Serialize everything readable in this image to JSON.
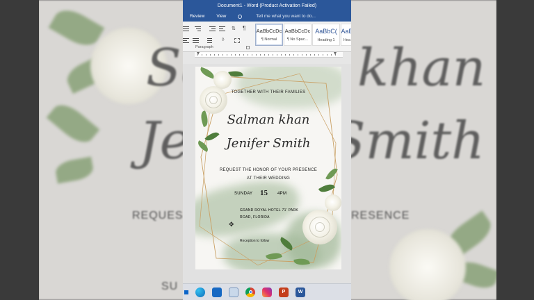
{
  "window": {
    "title": "Document1 - Word (Product Activation Failed)"
  },
  "menu": {
    "tabs": [
      "Review",
      "View"
    ],
    "tell_me": "Tell me what you want to do..."
  },
  "ribbon": {
    "group_label": "Paragraph",
    "styles": [
      {
        "sample": "AaBbCcDc",
        "name": "¶ Normal"
      },
      {
        "sample": "AaBbCcDc",
        "name": "¶ No Spac..."
      },
      {
        "sample": "AaBbC(",
        "name": "Heading 1"
      },
      {
        "sample": "AaB",
        "name": "Hea"
      }
    ]
  },
  "invitation": {
    "line1": "TOGETHER WITH THEIR  FAMILIES",
    "groom": "Salman khan",
    "bride": "Jenifer Smith",
    "request1": "REQUEST THE HONOR OF YOUR PRESENCE",
    "request2": "AT THEIR WEDDING",
    "day": "SUNDAY",
    "date": "15",
    "time": "4PM",
    "venue1": "GRAND ROYAL HOTEL 71' PARK",
    "venue2": "ROAD, FLORIDA",
    "reception": "Reception to follow"
  },
  "background": {
    "script1": "Salman khan",
    "script2": "Jenifer Smith",
    "caps_left": "REQUES",
    "caps_right": "RESENCE",
    "caps_bottom": "SU"
  },
  "taskbar": {
    "icons": [
      "windows-icon",
      "edge-icon",
      "store-icon",
      "monitor-icon",
      "chrome-icon",
      "instagram-icon",
      "powerpoint-icon",
      "word-icon"
    ]
  },
  "colors": {
    "word_blue": "#2b579a",
    "gold": "#c9a064",
    "leaf": "#6f9a55"
  }
}
